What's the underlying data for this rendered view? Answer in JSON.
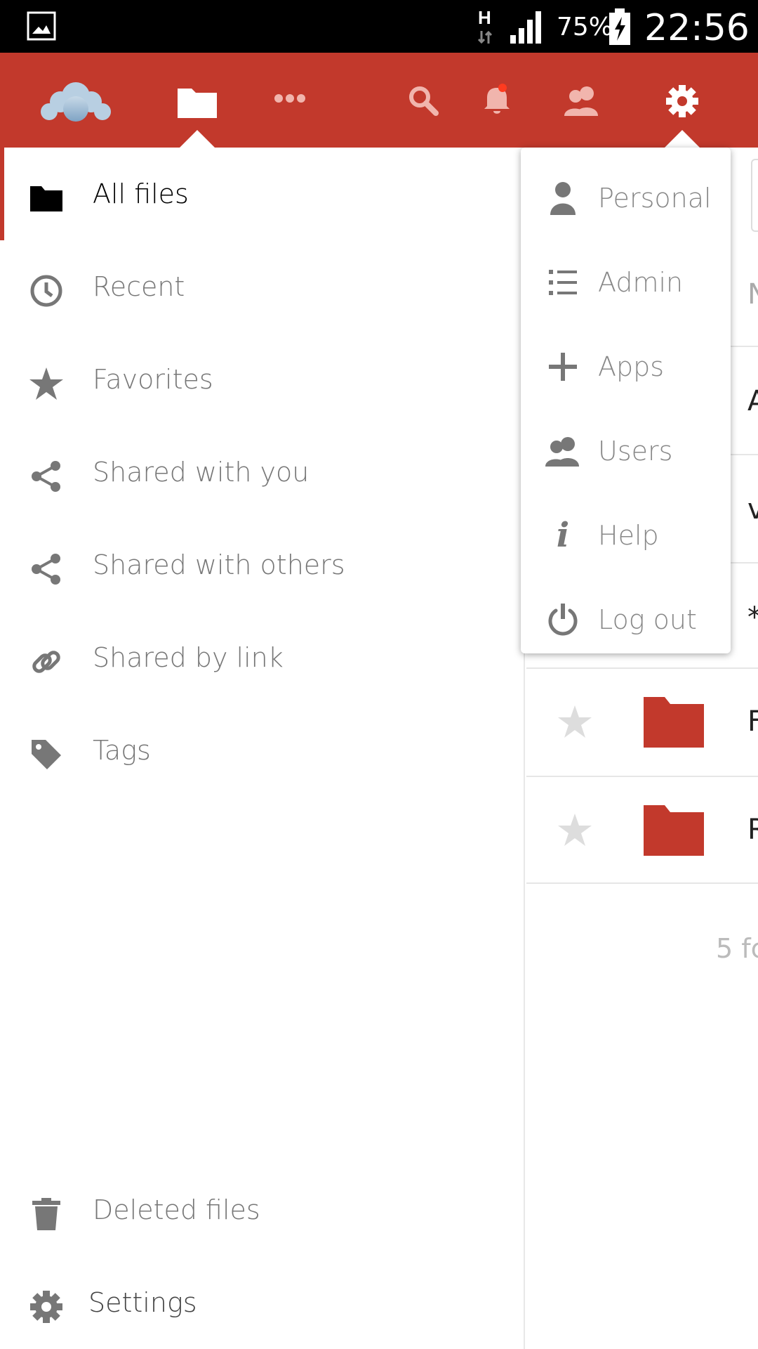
{
  "status_bar": {
    "network": "H",
    "battery_percent": "75%",
    "time": "22:56",
    "icons": [
      "image-icon",
      "network-icon",
      "signal-icon",
      "battery-charging-icon"
    ]
  },
  "header": {
    "icons": [
      "owncloud-logo",
      "files-folder-icon",
      "more-apps-icon",
      "search-icon",
      "notifications-bell-icon",
      "contacts-icon",
      "settings-gear-icon"
    ],
    "accent_color": "#c2392c",
    "notification_dot_color": "#ff3b1f"
  },
  "nav": {
    "items": [
      {
        "label": "All files",
        "icon": "folder-icon",
        "active": true
      },
      {
        "label": "Recent",
        "icon": "clock-icon"
      },
      {
        "label": "Favorites",
        "icon": "star-icon"
      },
      {
        "label": "Shared with you",
        "icon": "share-icon"
      },
      {
        "label": "Shared with others",
        "icon": "share-icon"
      },
      {
        "label": "Shared by link",
        "icon": "link-icon"
      },
      {
        "label": "Tags",
        "icon": "tag-icon"
      }
    ],
    "bottom": [
      {
        "label": "Deleted files",
        "icon": "trash-icon"
      },
      {
        "label": "Settings",
        "icon": "gear-icon"
      }
    ]
  },
  "settings_menu": {
    "items": [
      {
        "label": "Personal",
        "icon": "person-icon"
      },
      {
        "label": "Admin",
        "icon": "list-icon"
      },
      {
        "label": "Apps",
        "icon": "plus-icon"
      },
      {
        "label": "Users",
        "icon": "users-icon"
      },
      {
        "label": "Help",
        "icon": "info-icon"
      },
      {
        "label": "Log out",
        "icon": "power-icon"
      }
    ]
  },
  "content": {
    "column_header_fragment": "N",
    "row_fragments": [
      "A",
      "v",
      "*",
      "F",
      "R"
    ],
    "summary_fragment": "5 fc",
    "folder_color": "#c2392c"
  }
}
